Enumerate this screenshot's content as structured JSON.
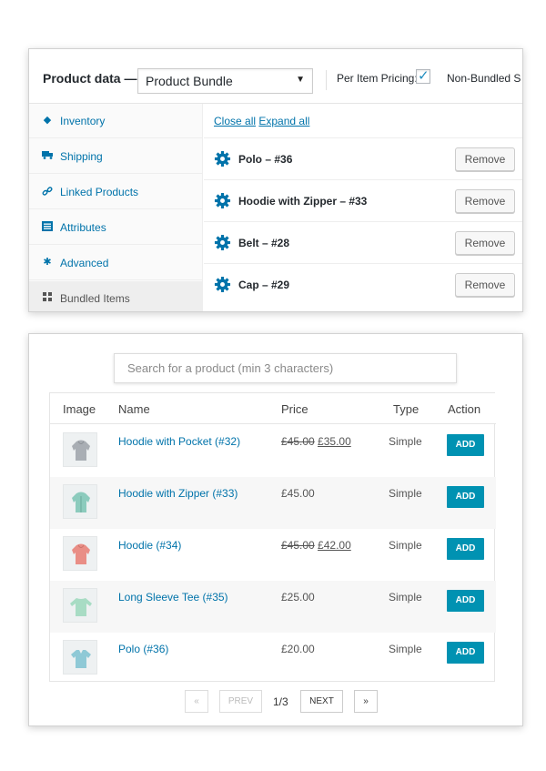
{
  "product_data": {
    "title": "Product data —",
    "type_select": "Product Bundle",
    "per_item_pricing_label": "Per Item Pricing:",
    "per_item_pricing_checked": true,
    "non_bundled_label": "Non-Bundled S"
  },
  "tabs": [
    {
      "label": "Inventory",
      "icon": "tag-icon"
    },
    {
      "label": "Shipping",
      "icon": "truck-icon"
    },
    {
      "label": "Linked Products",
      "icon": "link-icon"
    },
    {
      "label": "Attributes",
      "icon": "list-icon"
    },
    {
      "label": "Advanced",
      "icon": "gear-icon"
    },
    {
      "label": "Bundled Items",
      "icon": "grid-icon",
      "active": true
    }
  ],
  "bundle_actions": {
    "close_all": "Close all",
    "expand_all": "Expand all"
  },
  "bundled_items": [
    {
      "name": "Polo – #36",
      "remove": "Remove"
    },
    {
      "name": "Hoodie with Zipper – #33",
      "remove": "Remove"
    },
    {
      "name": "Belt – #28",
      "remove": "Remove"
    },
    {
      "name": "Cap – #29",
      "remove": "Remove"
    }
  ],
  "search": {
    "placeholder": "Search for a product (min 3 characters)"
  },
  "table": {
    "headers": {
      "image": "Image",
      "name": "Name",
      "price": "Price",
      "type": "Type",
      "action": "Action"
    },
    "rows": [
      {
        "name": "Hoodie with Pocket (#32)",
        "price_old": "£45.00",
        "price_new": "£35.00",
        "price": "",
        "type": "Simple",
        "action": "ADD",
        "thumb_color": "#a9aeb4"
      },
      {
        "name": "Hoodie with Zipper (#33)",
        "price_old": "",
        "price_new": "",
        "price": "£45.00",
        "type": "Simple",
        "action": "ADD",
        "thumb_color": "#8ccbbd"
      },
      {
        "name": "Hoodie (#34)",
        "price_old": "£45.00",
        "price_new": "£42.00",
        "price": "",
        "type": "Simple",
        "action": "ADD",
        "thumb_color": "#e98e86"
      },
      {
        "name": "Long Sleeve Tee (#35)",
        "price_old": "",
        "price_new": "",
        "price": "£25.00",
        "type": "Simple",
        "action": "ADD",
        "thumb_color": "#a8dcc4"
      },
      {
        "name": "Polo (#36)",
        "price_old": "",
        "price_new": "",
        "price": "£20.00",
        "type": "Simple",
        "action": "ADD",
        "thumb_color": "#8fc9d6"
      }
    ]
  },
  "pagination": {
    "first": "«",
    "prev": "PREV",
    "info": "1/3",
    "next": "NEXT",
    "last": "»"
  },
  "colors": {
    "link": "#0073aa",
    "add_button": "#0092b2",
    "check": "#1e8cbe"
  }
}
